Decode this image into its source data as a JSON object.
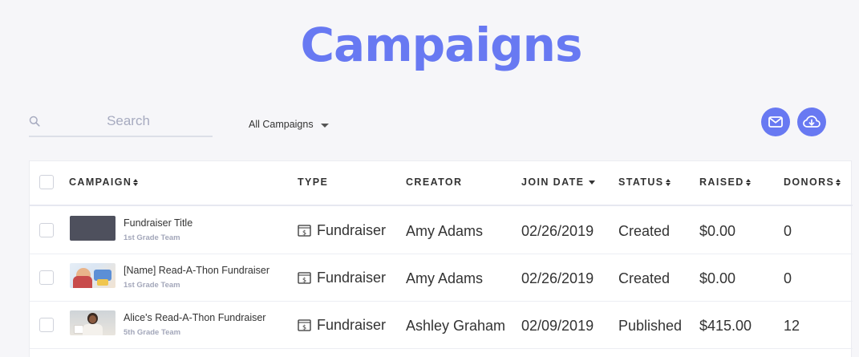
{
  "page": {
    "title": "Campaigns"
  },
  "search": {
    "placeholder": "Search",
    "value": ""
  },
  "filter": {
    "label": "All Campaigns"
  },
  "actions": {
    "email_icon": "mail-icon",
    "download_icon": "cloud-download-icon"
  },
  "colors": {
    "accent": "#6879f2",
    "muted": "#a3a7ba",
    "text": "#333333"
  },
  "table": {
    "headers": {
      "campaign": "Campaign",
      "type": "Type",
      "creator": "Creator",
      "join_date": "Join Date",
      "status": "Status",
      "raised": "Raised",
      "donors": "Donors"
    },
    "rows": [
      {
        "name": "Fundraiser Title",
        "team": "1st Grade Team",
        "thumb": "dark",
        "type": "Fundraiser",
        "creator": "Amy Adams",
        "join_date": "02/26/2019",
        "status": "Created",
        "raised": "$0.00",
        "donors": "0"
      },
      {
        "name": "[Name] Read-A-Thon Fundraiser",
        "team": "1st Grade Team",
        "thumb": "art",
        "type": "Fundraiser",
        "creator": "Amy Adams",
        "join_date": "02/26/2019",
        "status": "Created",
        "raised": "$0.00",
        "donors": "0"
      },
      {
        "name": "Alice's Read-A-Thon Fundraiser",
        "team": "5th Grade Team",
        "thumb": "photo",
        "type": "Fundraiser",
        "creator": "Ashley Graham",
        "join_date": "02/09/2019",
        "status": "Published",
        "raised": "$415.00",
        "donors": "12"
      }
    ]
  }
}
